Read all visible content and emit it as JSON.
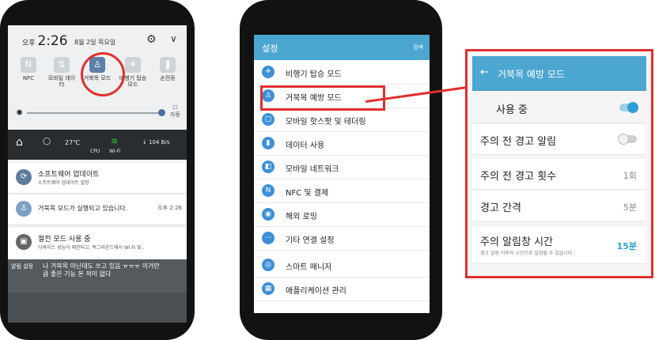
{
  "phone1": {
    "time_prefix": "오후",
    "time": "2:26",
    "date": "8월 2일 목요일",
    "tiles": [
      {
        "label": "NFC",
        "icon": "nfc-icon"
      },
      {
        "label": "모바일 데이터",
        "icon": "mobile-data-icon"
      },
      {
        "label": "거북목 모드",
        "icon": "turtle-neck-icon"
      },
      {
        "label": "비행기 탑승 모드",
        "icon": "airplane-icon"
      },
      {
        "label": "손전등",
        "icon": "flashlight-icon"
      }
    ],
    "brightness_auto": "자동",
    "brightness_level": 0.9,
    "status_row": {
      "temp": "27℃",
      "cpu_label": "CPU",
      "wifi_label": "Wi-Fi",
      "speed": "↓ 104 B/s"
    },
    "notifications": [
      {
        "title": "소프트웨어 업데이트",
        "subtitle": "소프트웨어 업데이트 설정",
        "time": ""
      },
      {
        "title": "거북목 모드가 실행되고 있습니다.",
        "subtitle": "",
        "time": "오후 2:26"
      },
      {
        "title": "절전 모드 사용 중",
        "subtitle": "디바이스 성능이 제한되고, 백그라운드에서 Wi-Fi 및..",
        "time": ""
      }
    ],
    "toast_label": "알림 설정",
    "toast_text": "나 거북목 아닌데도 쓰고 있음 ㅠㅠㅠ 이거만큼 좋은 기능 본 적이 없다"
  },
  "phone2": {
    "header_title": "설정",
    "header_action": "검색",
    "items": [
      {
        "label": "비행기 탑승 모드",
        "icon": "airplane-icon",
        "color": "#3e8fd8"
      },
      {
        "label": "거북목 예방 모드",
        "icon": "turtle-neck-icon",
        "color": "#3e8fd8"
      },
      {
        "label": "모바일 핫스팟 및 테더링",
        "icon": "hotspot-icon",
        "color": "#3e8fd8"
      },
      {
        "label": "데이터 사용",
        "icon": "data-usage-icon",
        "color": "#3e8fd8"
      },
      {
        "label": "모바일 네트워크",
        "icon": "mobile-network-icon",
        "color": "#3e8fd8"
      },
      {
        "label": "NFC 및 결제",
        "icon": "nfc-icon",
        "color": "#3e8fd8"
      },
      {
        "label": "해외 로밍",
        "icon": "roaming-icon",
        "color": "#3e8fd8"
      },
      {
        "label": "기타 연결 설정",
        "icon": "more-connections-icon",
        "color": "#3e8fd8"
      },
      {
        "label": "스마트 매니저",
        "icon": "smart-manager-icon",
        "color": "#3e8fd8"
      },
      {
        "label": "애플리케이션 관리",
        "icon": "apps-icon",
        "color": "#3e8fd8"
      }
    ]
  },
  "panel": {
    "title": "거북목 예방 모드",
    "in_use": "사용 중",
    "warning_alert": "주의 전 경고 알림",
    "warning_count": "주의 전 경고 횟수",
    "warning_count_value": "1회",
    "warning_interval": "경고 간격",
    "warning_interval_value": "5분",
    "alert_duration": "주의 알림창 시간",
    "alert_duration_sub": "경고 알림 이후의 시간으로 설정할 수 있습니다.",
    "alert_duration_value": "15분"
  },
  "colors": {
    "accent": "#4ba6d0",
    "highlight": "#e0302e"
  }
}
